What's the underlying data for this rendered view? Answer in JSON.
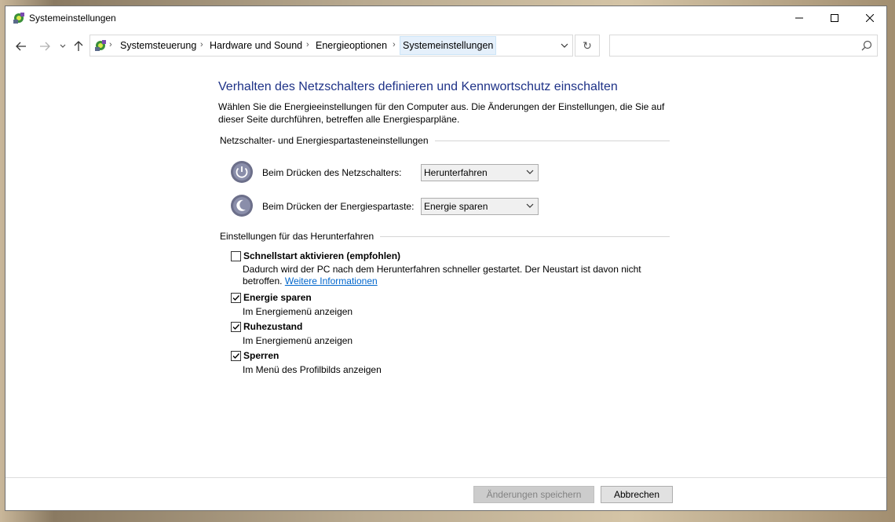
{
  "window": {
    "title": "Systemeinstellungen"
  },
  "nav": {
    "breadcrumbs": [
      "Systemsteuerung",
      "Hardware und Sound",
      "Energieoptionen",
      "Systemeinstellungen"
    ],
    "search_placeholder": ""
  },
  "main": {
    "heading": "Verhalten des Netzschalters definieren und Kennwortschutz einschalten",
    "intro": "Wählen Sie die Energieeinstellungen für den Computer aus. Die Änderungen der Einstellungen, die Sie auf dieser Seite durchführen, betreffen alle Energiesparpläne.",
    "power_group": {
      "title": "Netzschalter- und Energiespartasteneinstellungen",
      "power_button": {
        "label": "Beim Drücken des Netzschalters:",
        "value": "Herunterfahren"
      },
      "sleep_button": {
        "label": "Beim Drücken der Energiespartaste:",
        "value": "Energie sparen"
      }
    },
    "shutdown_group": {
      "title": "Einstellungen für das Herunterfahren",
      "fast_startup": {
        "label": "Schnellstart aktivieren (empfohlen)",
        "checked": false,
        "desc_1": "Dadurch wird der PC nach dem Herunterfahren schneller gestartet. Der Neustart ist davon nicht",
        "desc_2": "betroffen.",
        "link": "Weitere Informationen"
      },
      "sleep": {
        "label": "Energie sparen",
        "checked": true,
        "desc": "Im Energiemenü anzeigen"
      },
      "hibernate": {
        "label": "Ruhezustand",
        "checked": true,
        "desc": "Im Energiemenü anzeigen"
      },
      "lock": {
        "label": "Sperren",
        "checked": true,
        "desc": "Im Menü des Profilbilds anzeigen"
      }
    }
  },
  "footer": {
    "save_label": "Änderungen speichern",
    "cancel_label": "Abbrechen"
  }
}
